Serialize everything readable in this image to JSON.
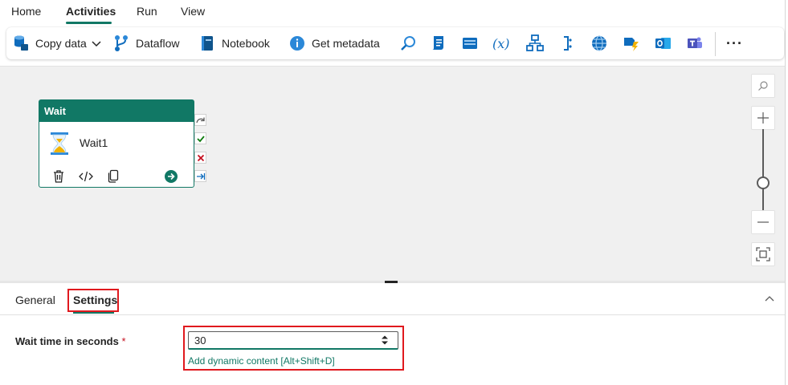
{
  "menu": {
    "items": [
      {
        "label": "Home",
        "active": false
      },
      {
        "label": "Activities",
        "active": true
      },
      {
        "label": "Run",
        "active": false
      },
      {
        "label": "View",
        "active": false
      }
    ]
  },
  "toolbar": {
    "copy_data_label": "Copy data",
    "dataflow_label": "Dataflow",
    "notebook_label": "Notebook",
    "get_metadata_label": "Get metadata",
    "icons": [
      "lookup-icon",
      "script-icon",
      "set-variable-icon",
      "expression-icon",
      "pipeline-icon",
      "if-condition-icon",
      "web-icon",
      "azure-function-icon",
      "outlook-icon",
      "teams-icon"
    ],
    "more_label": "···"
  },
  "activity": {
    "type_label": "Wait",
    "name": "Wait1"
  },
  "panel": {
    "tabs": [
      {
        "label": "General",
        "active": false
      },
      {
        "label": "Settings",
        "active": true
      }
    ],
    "wait_time": {
      "label": "Wait time in seconds",
      "required_mark": "*",
      "value": "30",
      "dynamic_link": "Add dynamic content [Alt+Shift+D]"
    }
  },
  "colors": {
    "accent": "#117865",
    "highlight": "#e0191e",
    "canvas": "#f0f0f0"
  }
}
